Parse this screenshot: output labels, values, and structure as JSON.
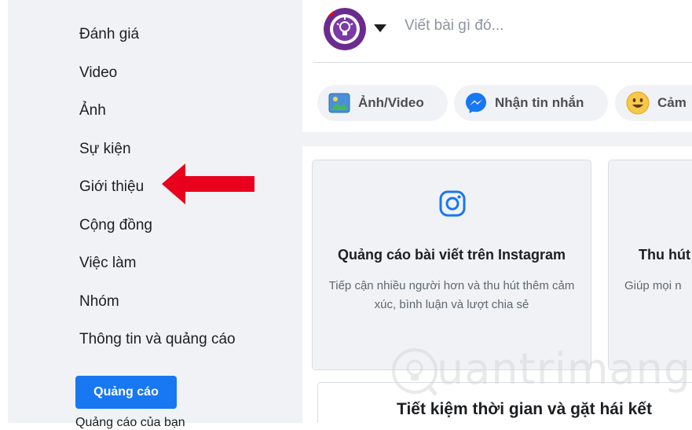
{
  "sidebar": {
    "items": [
      {
        "label": "Đánh giá"
      },
      {
        "label": "Video"
      },
      {
        "label": "Ảnh"
      },
      {
        "label": "Sự kiện"
      },
      {
        "label": "Giới thiệu"
      },
      {
        "label": "Cộng đồng"
      },
      {
        "label": "Việc làm"
      },
      {
        "label": "Nhóm"
      },
      {
        "label": "Thông tin và quảng cáo"
      }
    ],
    "ads_button": "Quảng cáo",
    "cut_text": "Quảng cáo của bạn"
  },
  "composer": {
    "placeholder": "Viết bài gì đó...",
    "actions": [
      {
        "label": "Ảnh/Video",
        "icon": "photo-icon"
      },
      {
        "label": "Nhận tin nhắn",
        "icon": "messenger-icon"
      },
      {
        "label": "Cảm",
        "icon": "smiley-icon"
      }
    ]
  },
  "cards": [
    {
      "icon": "instagram-icon",
      "title": "Quảng cáo bài viết trên Instagram",
      "description": "Tiếp cận nhiều người hơn và thu hút thêm cảm xúc, bình luận và lượt chia sẻ"
    },
    {
      "title": "Thu hút",
      "description": "Giúp mọi n"
    }
  ],
  "bottom_title": "Tiết kiệm thời gian và gặt hái kết",
  "watermark": "uantrimang",
  "colors": {
    "brand_blue": "#1877f2",
    "arrow_red": "#e8001c",
    "sidebar_bg": "#f0f2f5"
  }
}
